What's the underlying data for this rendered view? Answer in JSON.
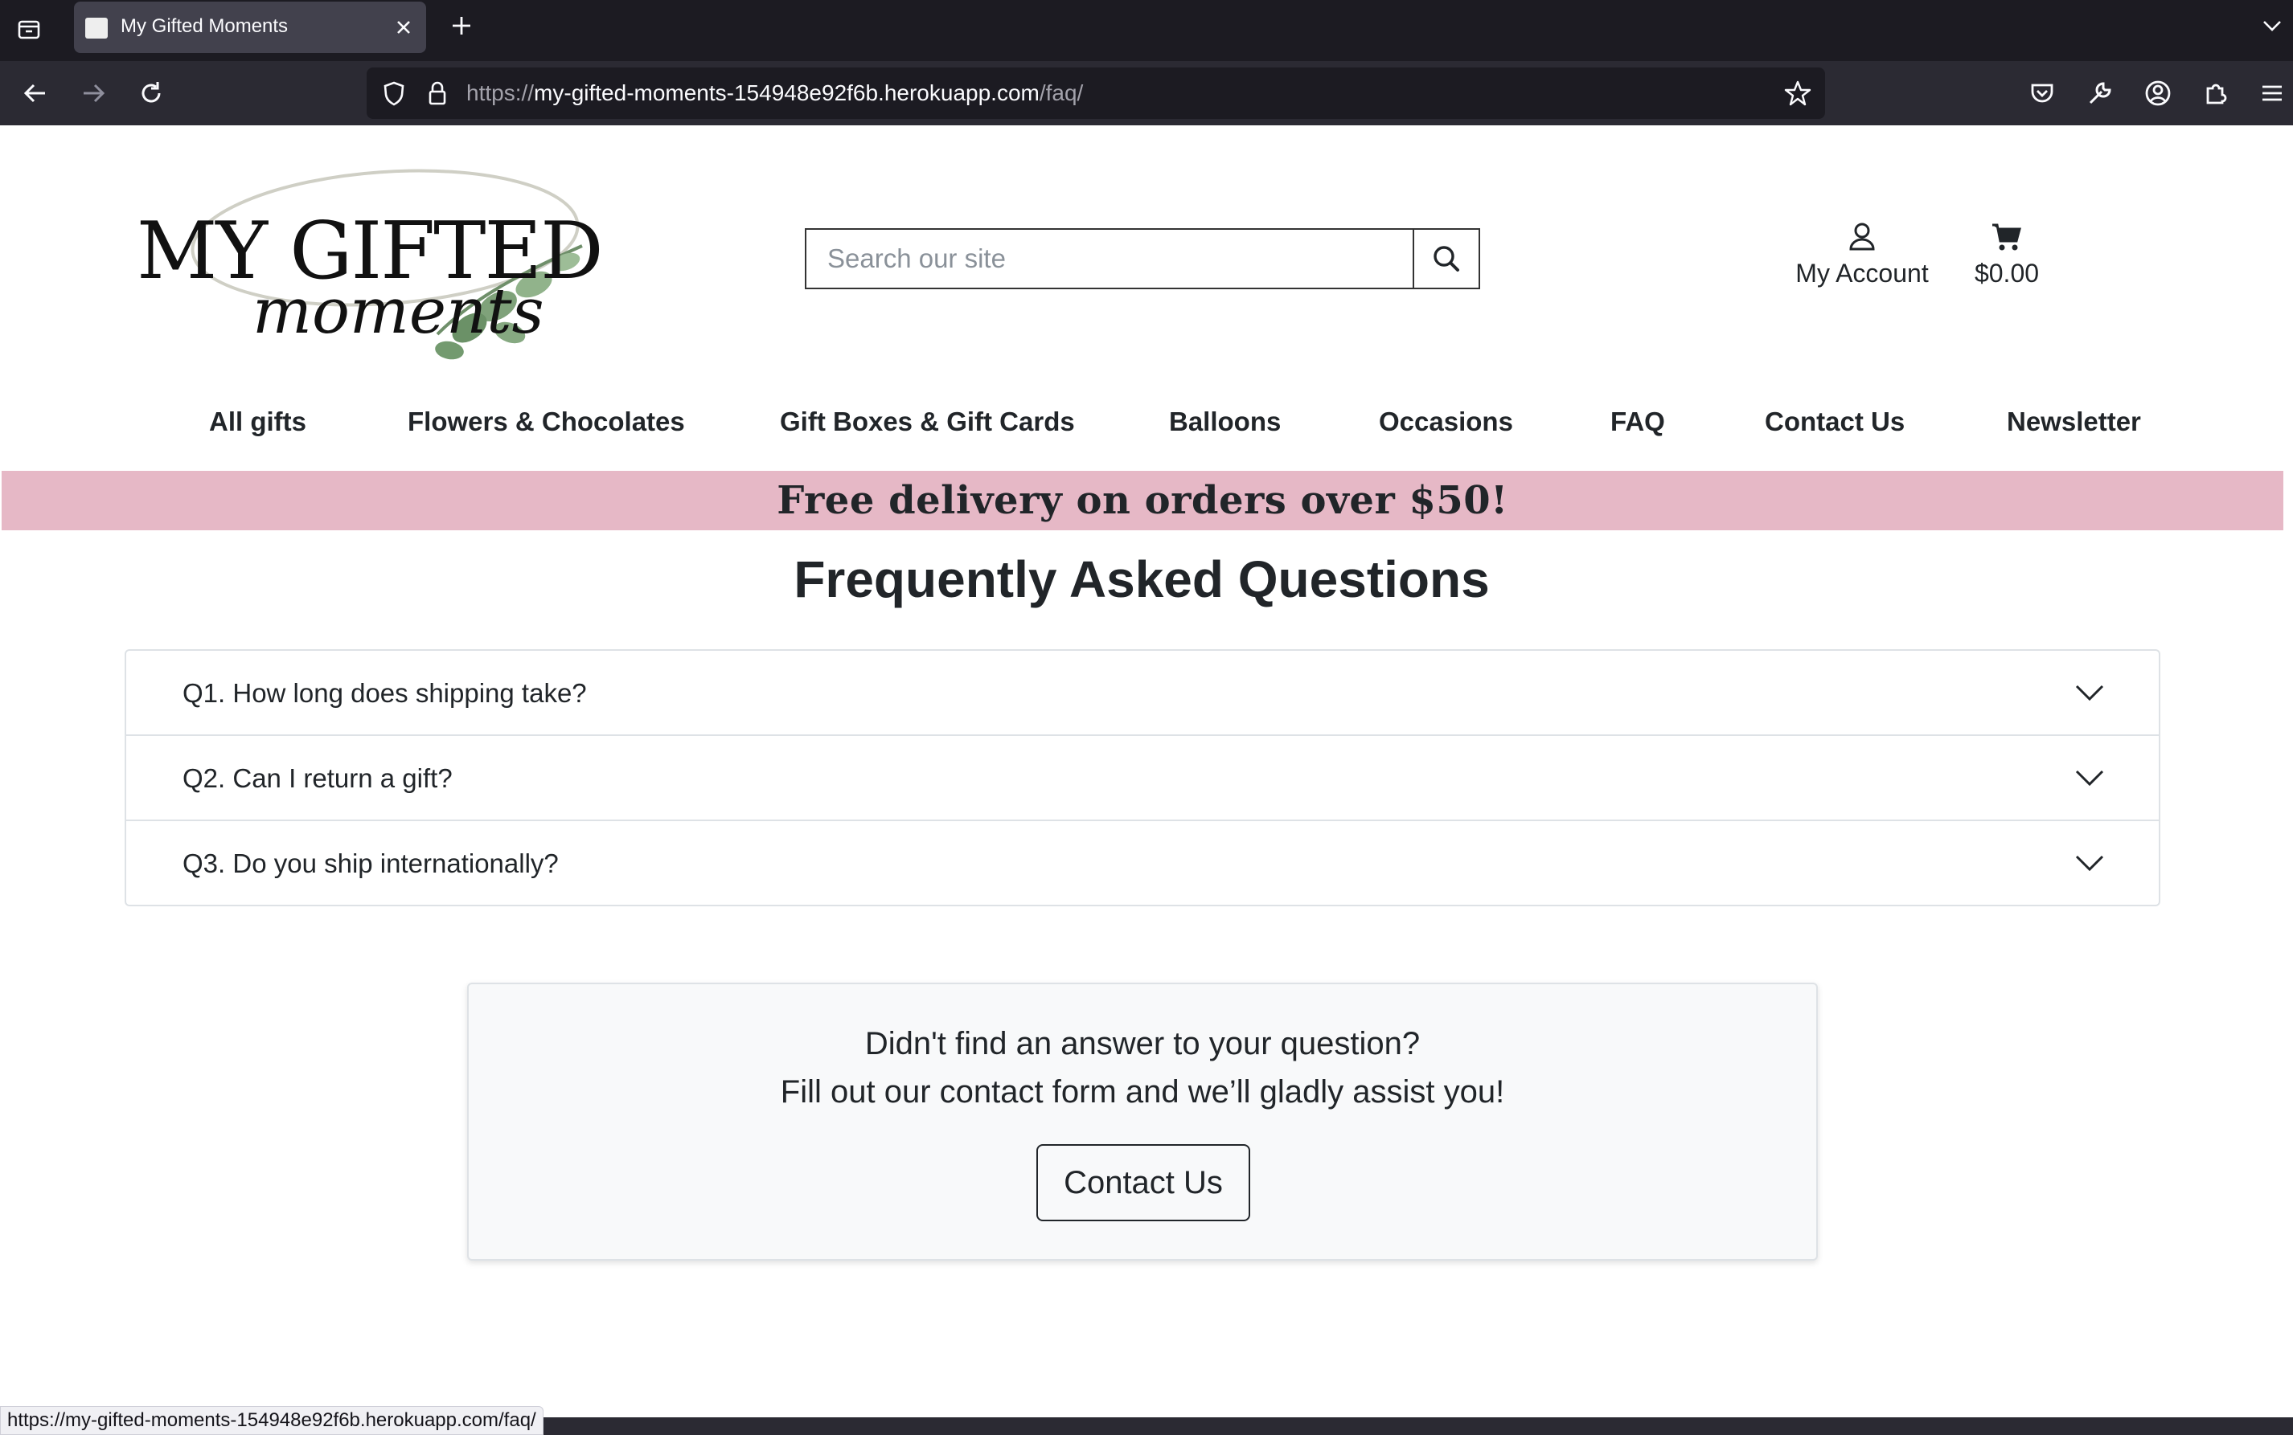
{
  "browser": {
    "tab_title": "My Gifted Moments",
    "url_prefix": "https://",
    "url_host": "my-gifted-moments-154948e92f6b.herokuapp.com",
    "url_path": "/faq/",
    "status_url": "https://my-gifted-moments-154948e92f6b.herokuapp.com/faq/"
  },
  "header": {
    "logo_line1": "MY GIFTED",
    "logo_line2": "moments",
    "search_placeholder": "Search our site",
    "account_label": "My Account",
    "cart_total": "$0.00"
  },
  "nav": {
    "items": [
      "All gifts",
      "Flowers & Chocolates",
      "Gift Boxes & Gift Cards",
      "Balloons",
      "Occasions",
      "FAQ",
      "Contact Us",
      "Newsletter"
    ]
  },
  "banner": {
    "text": "Free delivery on orders over $50!"
  },
  "faq": {
    "title": "Frequently Asked Questions",
    "questions": [
      "Q1. How long does shipping take?",
      "Q2. Can I return a gift?",
      "Q3. Do you ship internationally?"
    ]
  },
  "help": {
    "line1": "Didn't find an answer to your question?",
    "line2": "Fill out our contact form and we’ll gladly assist you!",
    "button_label": "Contact Us"
  },
  "colors": {
    "banner_bg": "#e6b8c6",
    "chrome_dark": "#1c1b22",
    "toolbar": "#2b2a33"
  }
}
